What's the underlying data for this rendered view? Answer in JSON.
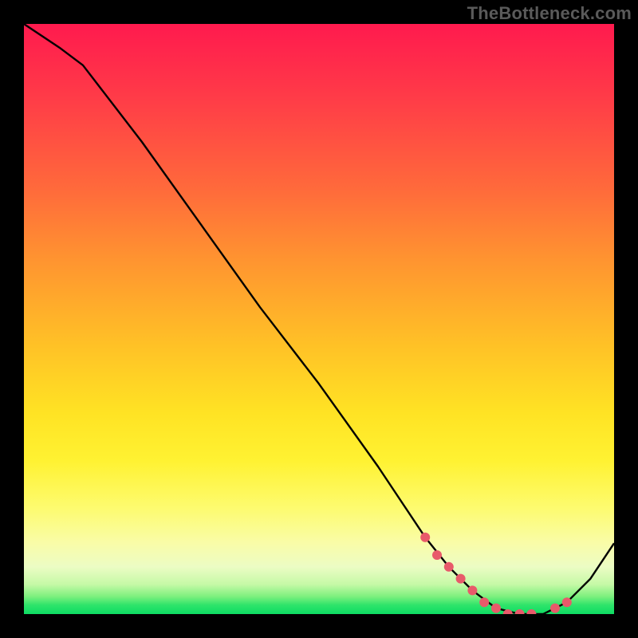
{
  "watermark": "TheBottleneck.com",
  "chart_data": {
    "type": "line",
    "title": "",
    "xlabel": "",
    "ylabel": "",
    "xlim": [
      0,
      100
    ],
    "ylim": [
      0,
      100
    ],
    "series": [
      {
        "name": "curve",
        "x": [
          0,
          6,
          10,
          20,
          30,
          40,
          50,
          60,
          68,
          72,
          76,
          80,
          84,
          88,
          92,
          96,
          100
        ],
        "values": [
          100,
          96,
          93,
          80,
          66,
          52,
          39,
          25,
          13,
          8,
          4,
          1,
          0,
          0,
          2,
          6,
          12
        ]
      }
    ],
    "markers": {
      "name": "highlight-dots",
      "x": [
        68,
        70,
        72,
        74,
        76,
        78,
        80,
        82,
        84,
        86,
        90,
        92
      ],
      "values": [
        13,
        10,
        8,
        6,
        4,
        2,
        1,
        0,
        0,
        0,
        1,
        2
      ]
    },
    "gradient_stops": [
      {
        "pos": 0,
        "color": "#ff1a4e"
      },
      {
        "pos": 0.4,
        "color": "#ff9430"
      },
      {
        "pos": 0.66,
        "color": "#ffe324"
      },
      {
        "pos": 0.88,
        "color": "#f9fca8"
      },
      {
        "pos": 1.0,
        "color": "#0edc63"
      }
    ]
  }
}
